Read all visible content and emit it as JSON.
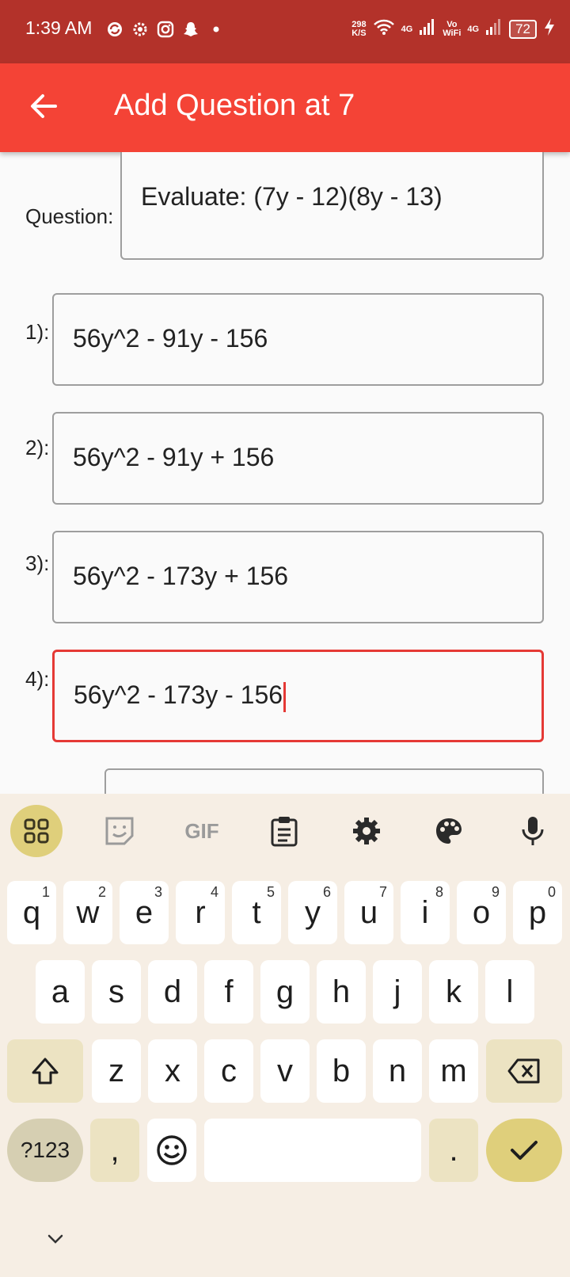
{
  "status_bar": {
    "time": "1:39 AM",
    "net_speed_value": "298",
    "net_speed_unit": "K/S",
    "sig1_label": "4G",
    "vowifi_top": "Vo",
    "vowifi_bottom": "WiFi",
    "sig2_label": "4G",
    "battery": "72",
    "icons": [
      "sync-icon",
      "settings-icon",
      "instagram-icon",
      "snapchat-icon",
      "dot-icon",
      "wifi-icon",
      "signal-icon",
      "charging-icon"
    ]
  },
  "app_bar": {
    "title": "Add Question at 7",
    "color": "#f44336"
  },
  "form": {
    "question_label": "Question:",
    "question_value": "Evaluate: (7y - 12)(8y - 13)",
    "options": [
      {
        "label": "1):",
        "value": "56y^2 - 91y - 156"
      },
      {
        "label": "2):",
        "value": "56y^2 - 91y + 156"
      },
      {
        "label": "3):",
        "value": "56y^2 - 173y + 156"
      },
      {
        "label": "4):",
        "value": "56y^2 - 173y - 156"
      }
    ],
    "focused_border_color": "#e53935"
  },
  "keyboard": {
    "toolbar": [
      "apps-icon",
      "sticker-icon",
      "gif-icon",
      "clipboard-icon",
      "settings-icon",
      "palette-icon",
      "mic-icon"
    ],
    "gif_label": "GIF",
    "row1": [
      {
        "k": "q",
        "h": "1"
      },
      {
        "k": "w",
        "h": "2"
      },
      {
        "k": "e",
        "h": "3"
      },
      {
        "k": "r",
        "h": "4"
      },
      {
        "k": "t",
        "h": "5"
      },
      {
        "k": "y",
        "h": "6"
      },
      {
        "k": "u",
        "h": "7"
      },
      {
        "k": "i",
        "h": "8"
      },
      {
        "k": "o",
        "h": "9"
      },
      {
        "k": "p",
        "h": "0"
      }
    ],
    "row2": [
      "a",
      "s",
      "d",
      "f",
      "g",
      "h",
      "j",
      "k",
      "l"
    ],
    "row3": [
      "z",
      "x",
      "c",
      "v",
      "b",
      "n",
      "m"
    ],
    "symbols_label": "?123",
    "comma_label": ",",
    "period_label": ".",
    "accent_color": "#dfcf7b"
  }
}
